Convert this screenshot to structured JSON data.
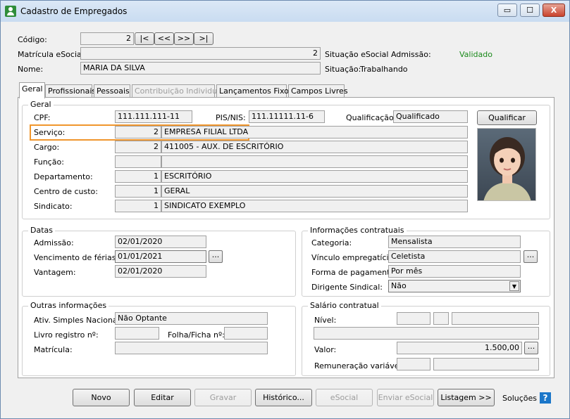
{
  "window": {
    "title": "Cadastro de Empregados",
    "min_label": "▭",
    "max_label": "☐",
    "close_label": "X"
  },
  "header": {
    "codigo_label": "Código:",
    "codigo_value": "2",
    "nav": {
      "first": "|<",
      "prev": "<<",
      "next": ">>",
      "last": ">|"
    },
    "matricula_label": "Matrícula eSocial:",
    "matricula_value": "2",
    "situacao_esocial_label": "Situação eSocial Admissão:",
    "situacao_esocial_value": "Validado",
    "nome_label": "Nome:",
    "nome_value": "MARIA DA SILVA",
    "situacao_label": "Situação:",
    "situacao_value": "Trabalhando"
  },
  "tabs": [
    "Geral",
    "Profissionais",
    "Pessoais",
    "Contribuição Individual",
    "Lançamentos Fixos",
    "Campos Livres"
  ],
  "geral": {
    "title": "Geral",
    "cpf_label": "CPF:",
    "cpf_value": "111.111.111-11",
    "pis_label": "PIS/NIS:",
    "pis_value": "111.11111.11-6",
    "qualificacao_label": "Qualificação:",
    "qualificacao_value": "Qualificado",
    "qualificar_button": "Qualificar",
    "rows": [
      {
        "label": "Serviço:",
        "code": "2",
        "desc": "EMPRESA FILIAL LTDA"
      },
      {
        "label": "Cargo:",
        "code": "2",
        "desc": "411005 - AUX. DE ESCRITÓRIO"
      },
      {
        "label": "Função:",
        "code": "",
        "desc": ""
      },
      {
        "label": "Departamento:",
        "code": "1",
        "desc": "ESCRITÓRIO"
      },
      {
        "label": "Centro de custo:",
        "code": "1",
        "desc": "GERAL"
      },
      {
        "label": "Sindicato:",
        "code": "1",
        "desc": "SINDICATO EXEMPLO"
      }
    ]
  },
  "datas": {
    "title": "Datas",
    "admissao_label": "Admissão:",
    "admissao_value": "02/01/2020",
    "vencimento_label": "Vencimento de férias:",
    "vencimento_value": "01/01/2021",
    "vantagem_label": "Vantagem:",
    "vantagem_value": "02/01/2020",
    "ellipsis": "..."
  },
  "contratuais": {
    "title": "Informações contratuais",
    "categoria_label": "Categoria:",
    "categoria_value": "Mensalista",
    "vinculo_label": "Vínculo empregatício:",
    "vinculo_value": "Celetista",
    "forma_label": "Forma de pagamento:",
    "forma_value": "Por mês",
    "dirigente_label": "Dirigente Sindical:",
    "dirigente_value": "Não",
    "ellipsis": "..."
  },
  "outras": {
    "title": "Outras informações",
    "simples_label": "Ativ. Simples Nacional:",
    "simples_value": "Não Optante",
    "livro_label": "Livro registro nº:",
    "livro_value": "",
    "folha_label": "Folha/Ficha nº:",
    "folha_value": "",
    "matricula_label": "Matrícula:",
    "matricula_value": ""
  },
  "salario": {
    "title": "Salário contratual",
    "nivel_label": "Nível:",
    "valor_label": "Valor:",
    "valor_value": "1.500,00",
    "remuneracao_label": "Remuneração variável:",
    "ellipsis": "..."
  },
  "footer": {
    "novo": "Novo",
    "editar": "Editar",
    "gravar": "Gravar",
    "historico": "Histórico...",
    "esocial": "eSocial",
    "enviar_esocial": "Enviar eSocial",
    "listagem": "Listagem >>",
    "solucoes": "Soluções",
    "help": "?"
  }
}
